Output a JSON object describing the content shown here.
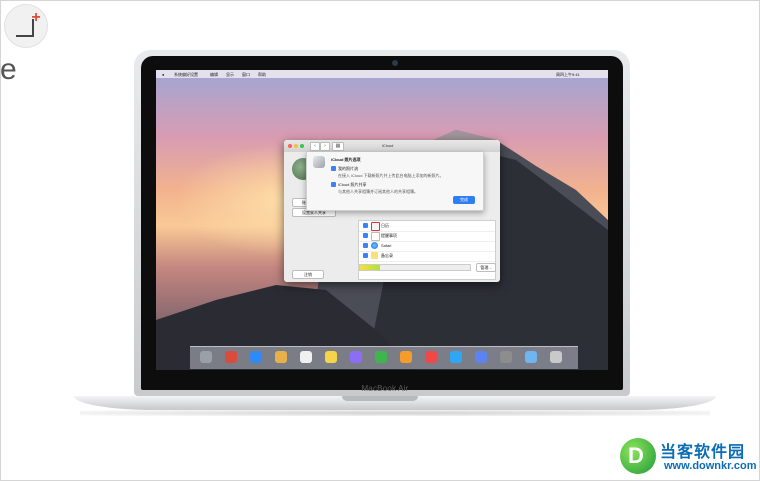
{
  "page": {
    "side_letter": "e"
  },
  "laptop": {
    "model_label": "MacBook Air"
  },
  "menubar": {
    "items": [
      "系统偏好设置",
      "编辑",
      "显示",
      "窗口",
      "帮助"
    ],
    "clock": "周四上午9:41"
  },
  "window": {
    "title": "iCloud",
    "sidebar_buttons": [
      "账户详细信息",
      "设置家人共享",
      "注销"
    ],
    "list_items": [
      {
        "label": "日历"
      },
      {
        "label": "提醒事项"
      },
      {
        "label": "Safari"
      },
      {
        "label": "备忘录"
      }
    ],
    "manage_button": "管理...",
    "storage_fraction": 0.18
  },
  "sheet": {
    "title": "iCloud 照片选项",
    "option1_label": "我的照片流",
    "option1_desc": "在接入 iCloud 下载新照片并上传此台电脑上添加的新照片。",
    "option2_label": "iCloud 照片共享",
    "option2_desc": "与其他人共享相簿并订阅其他人的共享相簿。",
    "done_button": "完成"
  },
  "watermark": {
    "title": "当客软件园",
    "url": "www.downkr.com"
  }
}
